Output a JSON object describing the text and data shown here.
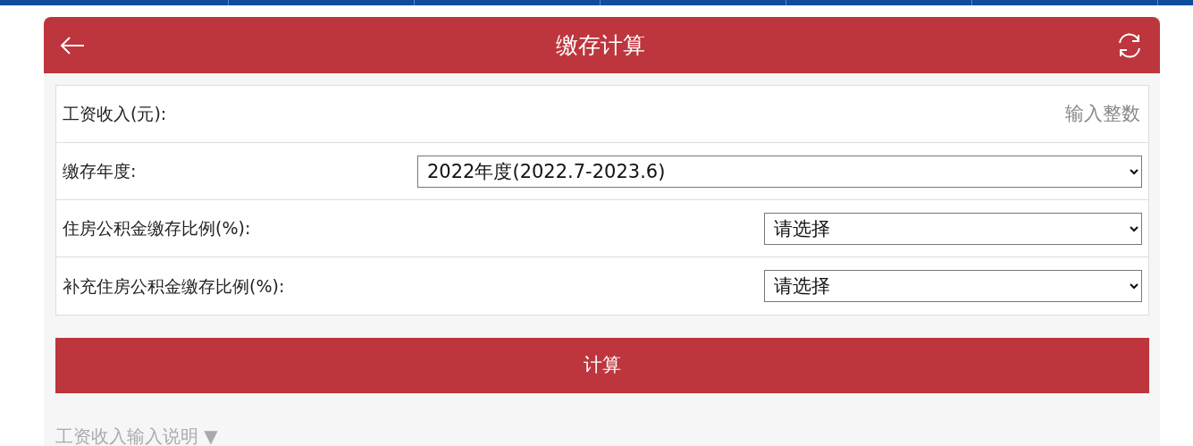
{
  "header": {
    "title": "缴存计算"
  },
  "form": {
    "rows": [
      {
        "kind": "input",
        "label": "工资收入(元):",
        "placeholder": "输入整数"
      },
      {
        "kind": "select",
        "label": "缴存年度:",
        "value": "2022年度(2022.7-2023.6)"
      },
      {
        "kind": "select",
        "label": "住房公积金缴存比例(%):",
        "value": "请选择"
      },
      {
        "kind": "select",
        "label": "补充住房公积金缴存比例(%):",
        "value": "请选择"
      }
    ]
  },
  "submit_button": "计算",
  "help_toggle": {
    "label": "工资收入输入说明",
    "arrow": "▼",
    "expanded": false
  }
}
